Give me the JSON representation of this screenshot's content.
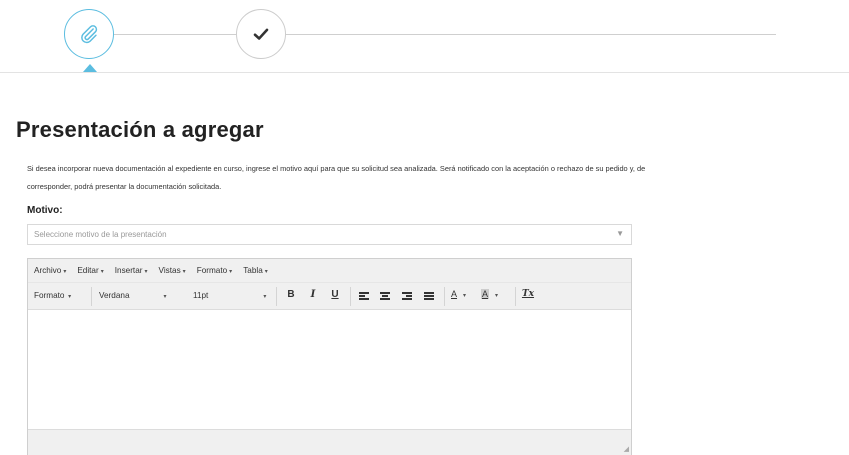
{
  "stepper": {
    "steps": [
      {
        "icon": "paperclip-icon",
        "state": "active"
      },
      {
        "icon": "checkmark-icon",
        "state": "pending"
      }
    ],
    "accent_color": "#5bbde0"
  },
  "page": {
    "title": "Presentación a agregar",
    "description": "Si desea incorporar nueva documentación al expediente en curso, ingrese el motivo aquí para que su solicitud sea analizada. Será notificado con la aceptación o rechazo de su pedido y, de corresponder, podrá presentar la documentación solicitada."
  },
  "motivo": {
    "label": "Motivo:",
    "placeholder": "Seleccione motivo de la presentación"
  },
  "editor": {
    "menu": [
      "Archivo",
      "Editar",
      "Insertar",
      "Vistas",
      "Formato",
      "Tabla"
    ],
    "toolbar": {
      "format_label": "Formato",
      "font_family": "Verdana",
      "font_size": "11pt",
      "bold": "B",
      "italic": "I",
      "underline": "U",
      "text_color": "A",
      "bg_color": "A",
      "clear_format": "Tx"
    },
    "content": ""
  }
}
